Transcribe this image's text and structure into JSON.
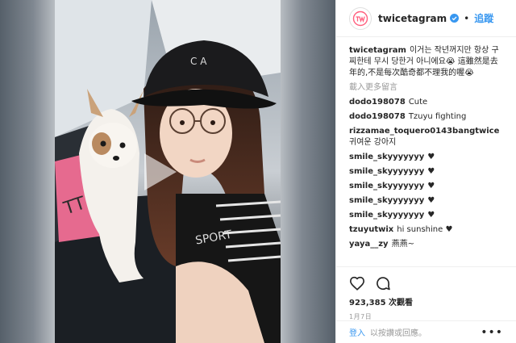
{
  "post": {
    "username": "twicetagram",
    "follow_label": "追蹤",
    "separator": "•"
  },
  "caption": {
    "user": "twicetagram",
    "text": "이거는 작년꺼지만 항상 구찌한테 무시 당한거 아니에요😭 這雖然是去年的,不是每次酷奇都不理我的喔😭"
  },
  "load_more_label": "載入更多留言",
  "comments": [
    {
      "user": "dodo198078",
      "text": "Cute"
    },
    {
      "user": "dodo198078",
      "text": "Tzuyu fighting"
    },
    {
      "user": "rizzamae_toquero0143bangtwice",
      "text": "귀여운 강아지"
    },
    {
      "user": "smile_skyyyyyyy",
      "text": "♥"
    },
    {
      "user": "smile_skyyyyyyy",
      "text": "♥"
    },
    {
      "user": "smile_skyyyyyyy",
      "text": "♥"
    },
    {
      "user": "smile_skyyyyyyy",
      "text": "♥"
    },
    {
      "user": "smile_skyyyyyyy",
      "text": "♥"
    },
    {
      "user": "tzuyutwix",
      "text": "hi sunshine ♥"
    },
    {
      "user": "yaya__zy",
      "text": "燕燕~"
    }
  ],
  "stats": {
    "views": "923,385 次觀看",
    "date": "1月7日"
  },
  "login": {
    "login_label": "登入",
    "hint": "以按讚或回應。",
    "more_label": "•••"
  },
  "colors": {
    "link_blue": "#3897f0",
    "verified_blue": "#3897f0",
    "twice_logo": "#ff5f7e"
  },
  "icons": [
    "verified-badge-icon",
    "play-icon",
    "heart-icon",
    "comment-icon",
    "more-options-icon",
    "twice-logo-icon"
  ]
}
